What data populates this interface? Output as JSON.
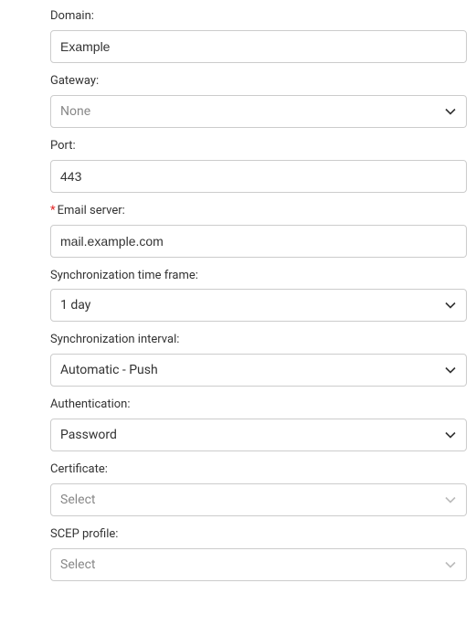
{
  "fields": {
    "domain": {
      "label": "Domain:",
      "value": "Example"
    },
    "gateway": {
      "label": "Gateway:",
      "placeholder": "None",
      "selected": ""
    },
    "port": {
      "label": "Port:",
      "value": "443"
    },
    "email_server": {
      "label": "Email server:",
      "value": "mail.example.com",
      "required": true
    },
    "sync_timeframe": {
      "label": "Synchronization time frame:",
      "selected": "1 day"
    },
    "sync_interval": {
      "label": "Synchronization interval:",
      "selected": "Automatic - Push"
    },
    "authentication": {
      "label": "Authentication:",
      "selected": "Password"
    },
    "certificate": {
      "label": "Certificate:",
      "placeholder": "Select",
      "selected": ""
    },
    "scep_profile": {
      "label": "SCEP profile:",
      "placeholder": "Select",
      "selected": ""
    }
  }
}
